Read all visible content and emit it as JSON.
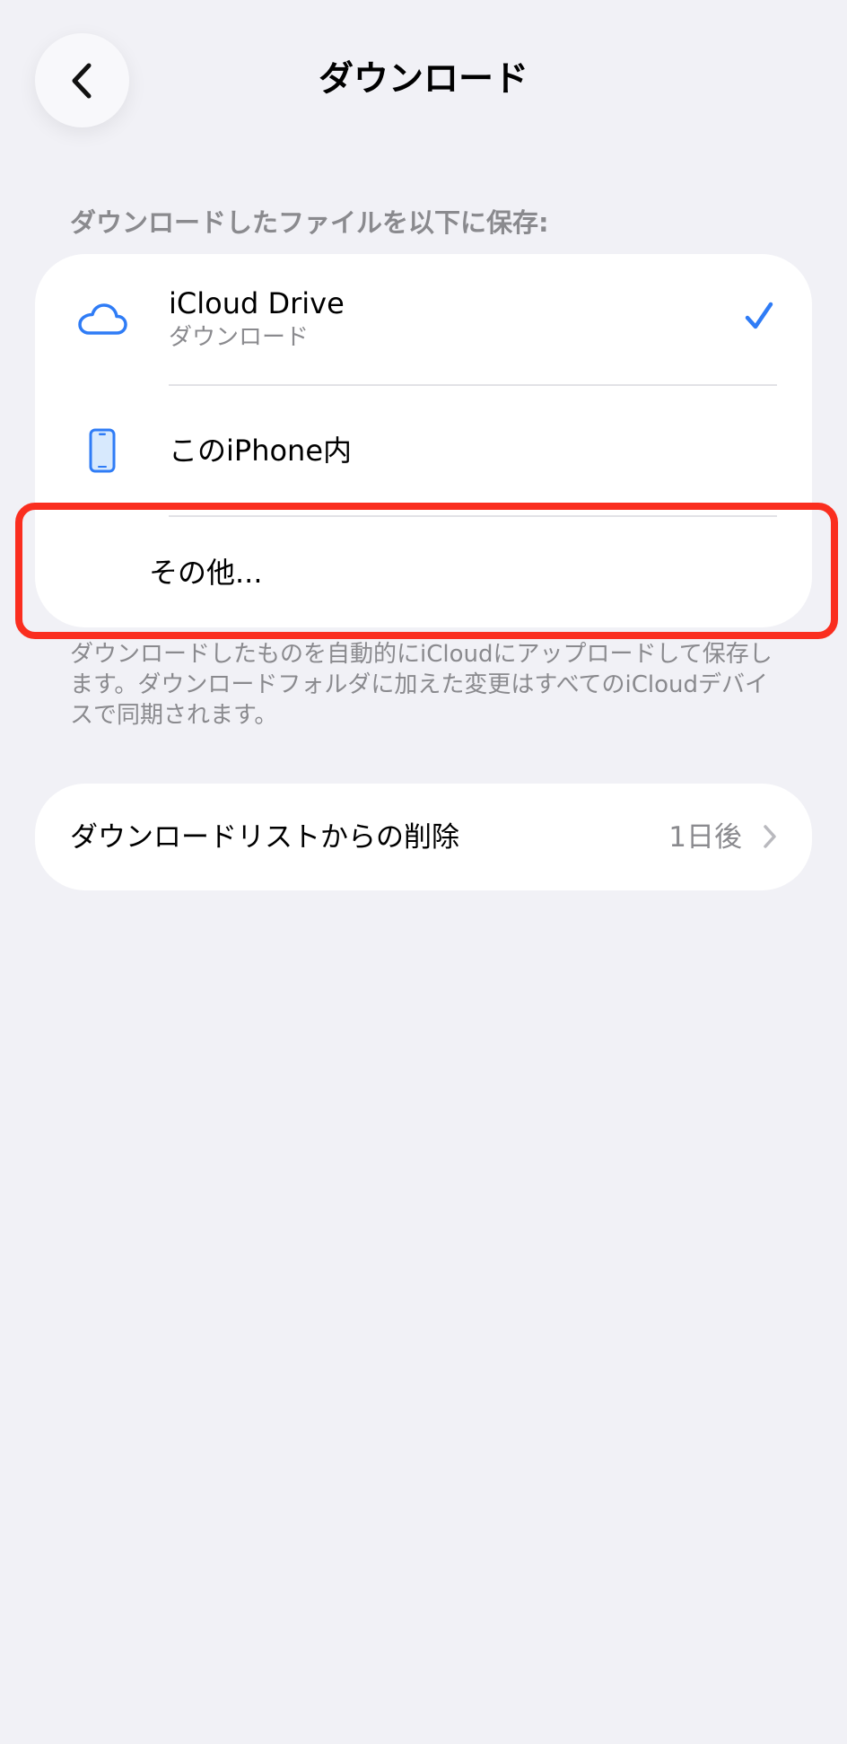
{
  "header": {
    "title": "ダウンロード"
  },
  "save_section": {
    "header": "ダウンロードしたファイルを以下に保存:",
    "options": [
      {
        "title": "iCloud Drive",
        "subtitle": "ダウンロード",
        "icon": "cloud-icon",
        "selected": true
      },
      {
        "title": "このiPhone内",
        "icon": "iphone-icon",
        "selected": false
      },
      {
        "title": "その他...",
        "selected": false
      }
    ],
    "footer": "ダウンロードしたものを自動的にiCloudにアップロードして保存します。ダウンロードフォルダに加えた変更はすべてのiCloudデバイスで同期されます。"
  },
  "remove_row": {
    "label": "ダウンロードリストからの削除",
    "value": "1日後"
  },
  "colors": {
    "background": "#f1f1f6",
    "accent": "#2f7cf6",
    "highlight": "#fa2e1f",
    "secondary_text": "#8a8a8e"
  },
  "icons": [
    "chevron-left-icon",
    "cloud-icon",
    "iphone-icon",
    "checkmark-icon",
    "chevron-right-icon"
  ]
}
